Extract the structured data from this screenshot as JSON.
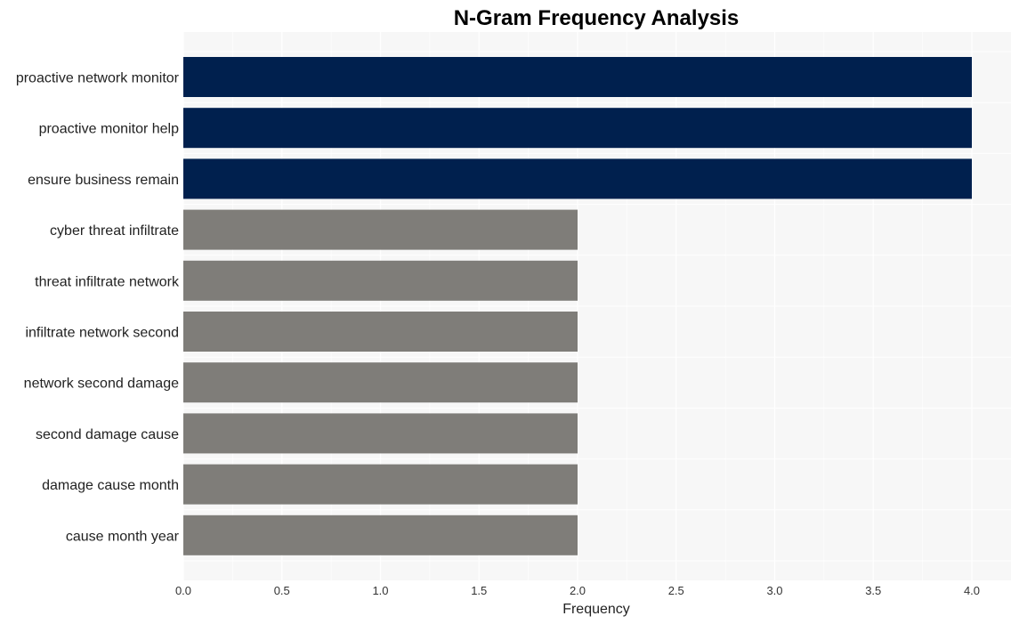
{
  "chart_data": {
    "type": "bar",
    "orientation": "horizontal",
    "title": "N-Gram Frequency Analysis",
    "xlabel": "Frequency",
    "ylabel": "",
    "xlim": [
      0,
      4.2
    ],
    "xticks": [
      "0.0",
      "0.5",
      "1.0",
      "1.5",
      "2.0",
      "2.5",
      "3.0",
      "3.5",
      "4.0"
    ],
    "grid": true,
    "categories": [
      "proactive network monitor",
      "proactive monitor help",
      "ensure business remain",
      "cyber threat infiltrate",
      "threat infiltrate network",
      "infiltrate network second",
      "network second damage",
      "second damage cause",
      "damage cause month",
      "cause month year"
    ],
    "values": [
      4,
      4,
      4,
      2,
      2,
      2,
      2,
      2,
      2,
      2
    ],
    "colors": {
      "highlight": "#00204e",
      "default": "#7f7d79",
      "plot_background": "#f7f7f7",
      "grid": "#ffffff"
    }
  }
}
